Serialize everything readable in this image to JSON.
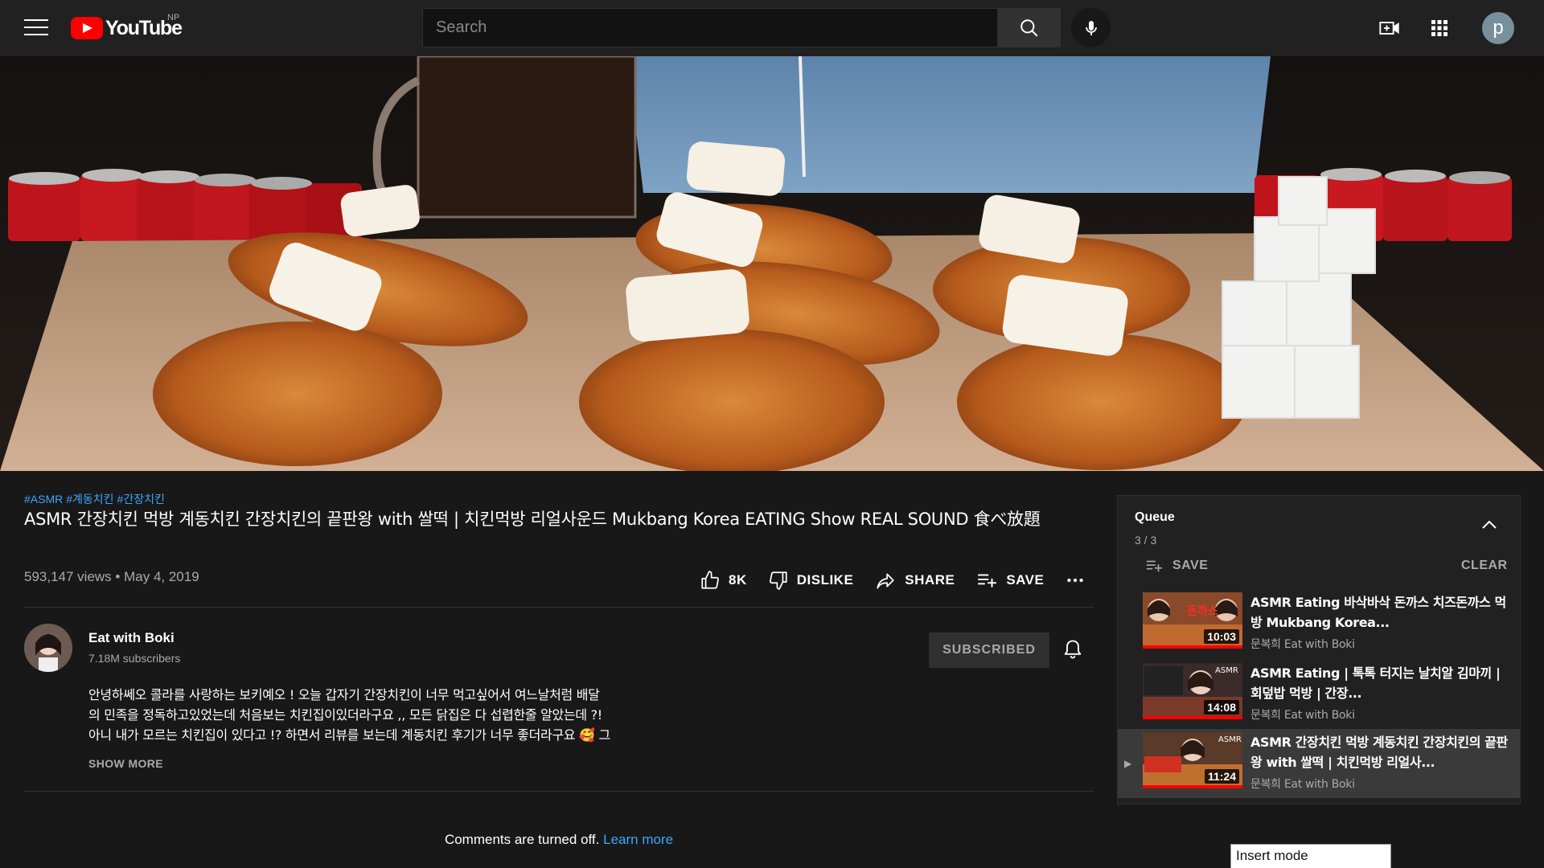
{
  "header": {
    "logo_text": "YouTube",
    "region": "NP",
    "search_placeholder": "Search",
    "avatar_letter": "p",
    "icons": [
      "menu-icon",
      "search-icon",
      "mic-icon",
      "create-video-icon",
      "apps-grid-icon"
    ]
  },
  "video": {
    "hashtags": [
      "#ASMR",
      "#계동치킨",
      "#간장치킨"
    ],
    "title": "ASMR 간장치킨 먹방 계동치킨 간장치킨의 끝판왕 with 쌀떡 | 치킨먹방 리얼사운드 Mukbang Korea EATING Show REAL SOUND 食べ放題",
    "views": "593,147 views",
    "date": "May 4, 2019",
    "like_count": "8K",
    "dislike_label": "DISLIKE",
    "share_label": "SHARE",
    "save_label": "SAVE"
  },
  "channel": {
    "name": "Eat with Boki",
    "subscribers": "7.18M subscribers",
    "subscribe_label": "SUBSCRIBED"
  },
  "description": {
    "text": "안녕하쎄오 콜라를 사랑하는 보키예오 ! 오늘 갑자기 간장치킨이 너무 먹고싶어서 여느날처럼 배달\n의 민족을 정독하고있었는데 처음보는 치킨집이있더라구요 ,, 모든 닭집은 다 섭렵한줄 알았는데 ?!\n아니 내가 모르는 치킨집이 있다고 !? 하면서 리뷰를 보는데 계동치킨 후기가 너무 좋더라구요 🥰 그",
    "show_more": "SHOW MORE"
  },
  "comments": {
    "text": "Comments are turned off.",
    "link": "Learn more"
  },
  "queue": {
    "title": "Queue",
    "count": "3 / 3",
    "save_label": "SAVE",
    "clear_label": "CLEAR",
    "items": [
      {
        "title": "ASMR Eating 바삭바삭 돈까스 치즈돈까스 먹방 Mukbang Korea...",
        "channel": "문복희 Eat with Boki",
        "duration": "10:03",
        "thumb_text": "돈까스",
        "thumb_subtext": "",
        "progress": 1.0
      },
      {
        "title": "ASMR Eating | 톡톡 터지는 날치알 김마끼 | 회덮밥 먹방 | 간장...",
        "channel": "문복희 Eat with Boki",
        "duration": "14:08",
        "thumb_text": "ASMR",
        "thumb_subtext": "",
        "progress": 1.0
      },
      {
        "title": "ASMR 간장치킨 먹방 계동치킨 간장치킨의 끝판왕 with 쌀떡 | 치킨먹방 리얼사...",
        "channel": "문복희 Eat with Boki",
        "duration": "11:24",
        "thumb_text": "ASMR",
        "thumb_subtext": "",
        "progress": 1.0,
        "active": true
      }
    ]
  },
  "status": {
    "insert_mode": "Insert mode"
  },
  "colors": {
    "background": "#181818",
    "header": "#212121",
    "accent_red": "#ff0000",
    "link_blue": "#3ea6ff"
  }
}
